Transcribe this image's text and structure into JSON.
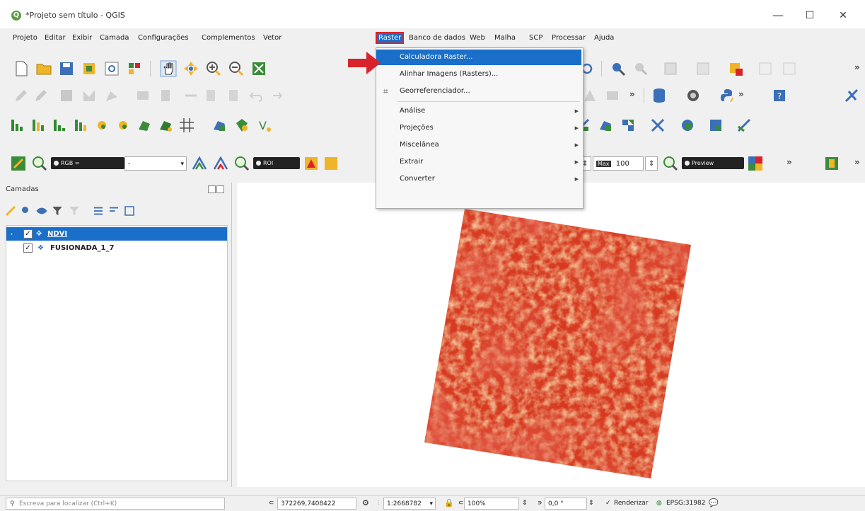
{
  "window": {
    "title": "*Projeto sem título - QGIS",
    "minimize": "—",
    "maximize": "☐",
    "close": "✕"
  },
  "menubar": [
    "Projeto",
    "Editar",
    "Exibir",
    "Camada",
    "Configurações",
    "Complementos",
    "Vetor",
    "Raster",
    "Banco de dados",
    "Web",
    "Malha",
    "SCP",
    "Processar",
    "Ajuda"
  ],
  "active_menu": "Raster",
  "raster_menu": [
    {
      "label": "Calculadora Raster...",
      "highlighted": true,
      "submenu": false
    },
    {
      "label": "Alinhar Imagens (Rasters)...",
      "highlighted": false,
      "submenu": false
    },
    {
      "label": "Georreferenciador...",
      "highlighted": false,
      "submenu": false,
      "icon": "georeferencer-icon"
    },
    {
      "label": "Análise",
      "highlighted": false,
      "submenu": true
    },
    {
      "label": "Projeções",
      "highlighted": false,
      "submenu": true
    },
    {
      "label": "Miscelânea",
      "highlighted": false,
      "submenu": true
    },
    {
      "label": "Extrair",
      "highlighted": false,
      "submenu": true
    },
    {
      "label": "Converter",
      "highlighted": false,
      "submenu": true
    }
  ],
  "toolbar4": {
    "rgb_chip": "RGB =",
    "combo_value": "-",
    "roi_chip": "ROI",
    "max_label": "Max",
    "max_value": "100",
    "preview_chip": "Preview"
  },
  "overflow": "»",
  "layers_panel": {
    "title": "Camadas",
    "layers": [
      {
        "name": "NDVI",
        "checked": true,
        "selected": true
      },
      {
        "name": "FUSIONADA_1_7",
        "checked": true,
        "selected": false
      }
    ]
  },
  "statusbar": {
    "search_placeholder": "Escreva para localizar (Ctrl+K)",
    "coordinate": "372269,7408422",
    "scale": "1:2668782",
    "magnifier": "100%",
    "rotation": "0,0 °",
    "render_label": "Renderizar",
    "render_checked": true,
    "crs": "EPSG:31982",
    "coordinate_prefix": "⊂",
    "scale_prefix": "⫶",
    "magnifier_prefix": "⊂",
    "rotation_prefix": "∍"
  },
  "colors": {
    "selection_blue": "#1a6fc8",
    "highlight_red": "#d9232a",
    "raster_dark": "#d73a21",
    "raster_light": "#f2cf7e"
  }
}
